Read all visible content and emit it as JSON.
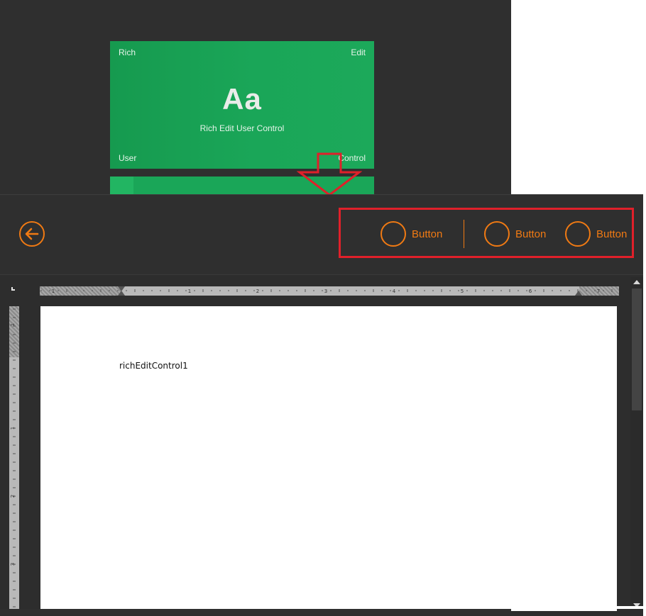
{
  "tile": {
    "top_left": "Rich",
    "top_right": "Edit",
    "bottom_left": "User",
    "bottom_right": "Control",
    "big_text": "Aa",
    "subtitle": "Rich Edit User Control"
  },
  "toolbar": {
    "buttons": [
      {
        "label": "Button"
      },
      {
        "label": "Button"
      },
      {
        "label": "Button"
      }
    ]
  },
  "ruler": {
    "h_marks": [
      "1",
      "1",
      "2",
      "3",
      "4",
      "5",
      "6",
      "7"
    ],
    "v_marks": [
      "1",
      "1",
      "2",
      "3"
    ]
  },
  "document": {
    "text": "richEditControl1"
  },
  "colors": {
    "accent": "#f07a13",
    "tile_green": "#1aa658",
    "highlight": "#e0202a",
    "background": "#2f2f2f"
  },
  "icons": {
    "back": "arrow-left-circle-icon",
    "button": "circle-icon"
  }
}
